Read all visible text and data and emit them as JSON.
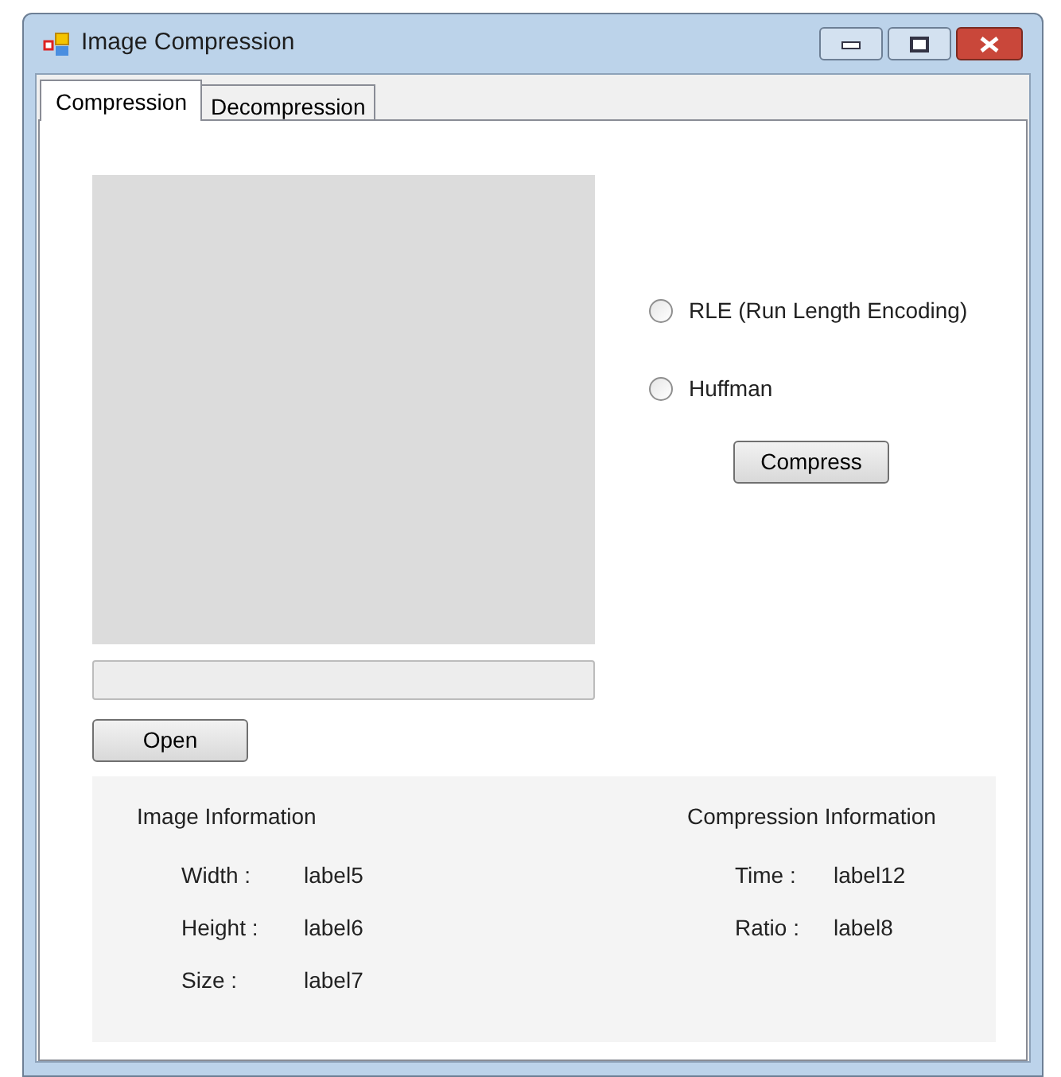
{
  "window": {
    "title": "Image Compression"
  },
  "tabs": [
    {
      "label": "Compression",
      "selected": true
    },
    {
      "label": "Decompression",
      "selected": false
    }
  ],
  "progress": {
    "level": 0
  },
  "options": [
    {
      "label": "RLE (Run Length Encoding)",
      "selected": false
    },
    {
      "label": "Huffman",
      "selected": false
    }
  ],
  "buttons": {
    "compress": "Compress",
    "open": "Open"
  },
  "image_information": {
    "title": "Image Information",
    "rows": [
      {
        "label": "Width :",
        "value": "label5"
      },
      {
        "label": "Height :",
        "value": "label6"
      },
      {
        "label": "Size :",
        "value": "label7"
      }
    ]
  },
  "compression_information": {
    "title": "Compression Information",
    "rows": [
      {
        "label": "Time :",
        "value": "label12"
      },
      {
        "label": "Ratio :",
        "value": "label8"
      }
    ]
  }
}
